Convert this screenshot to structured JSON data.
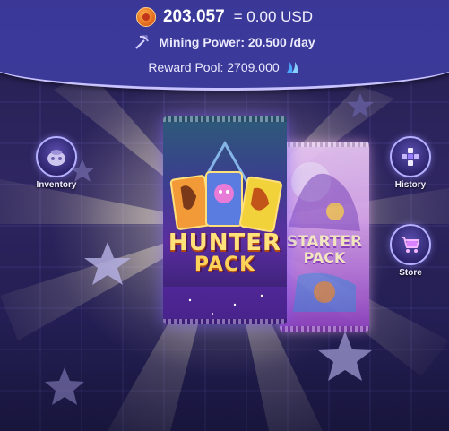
{
  "header": {
    "balance": "203.057",
    "usd_value": "= 0.00 USD",
    "mining_power": "Mining Power: 20.500 /day",
    "reward_pool": "Reward Pool: 2709.000",
    "icons": {
      "coin": "coin-icon",
      "mining": "pickaxe-icon",
      "reward": "steem-icon"
    },
    "colors": {
      "bar": "#3b3a9a",
      "border": "#c9c4ff"
    }
  },
  "side_buttons": {
    "inventory": {
      "label": "Inventory",
      "icon": "bag-icon"
    },
    "history": {
      "label": "History",
      "icon": "history-icon"
    },
    "store": {
      "label": "Store",
      "icon": "cart-icon"
    }
  },
  "packs": {
    "hunter": {
      "title_line1": "HUNTER",
      "title_line2": "PACK"
    },
    "starter": {
      "title_line1": "STARTER",
      "title_line2": "PACK"
    }
  }
}
